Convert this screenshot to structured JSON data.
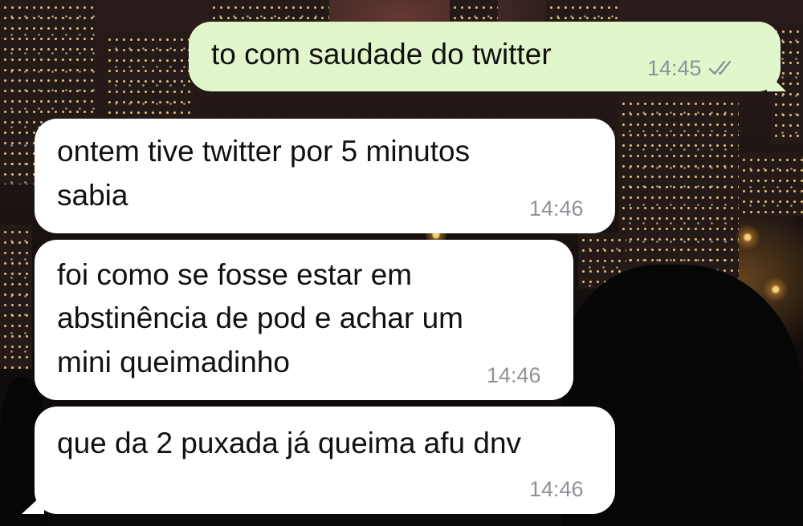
{
  "chat": {
    "messages": [
      {
        "direction": "outgoing",
        "lines": [
          "to com saudade do twitter"
        ],
        "time": "14:45",
        "status_icon": "double-check-icon"
      },
      {
        "direction": "incoming",
        "lines": [
          "ontem tive twitter por 5 minutos",
          "sabia"
        ],
        "time": "14:46"
      },
      {
        "direction": "incoming",
        "lines": [
          "foi como se fosse estar em",
          "abstinência de pod e achar um",
          "mini queimadinho"
        ],
        "time": "14:46"
      },
      {
        "direction": "incoming",
        "lines": [
          "que da 2 puxada já queima afu dnv"
        ],
        "time": "14:46"
      }
    ]
  },
  "colors": {
    "outgoing_bubble": "#e1f7cb",
    "incoming_bubble": "#ffffff",
    "timestamp": "#8d9298",
    "text": "#111111"
  }
}
